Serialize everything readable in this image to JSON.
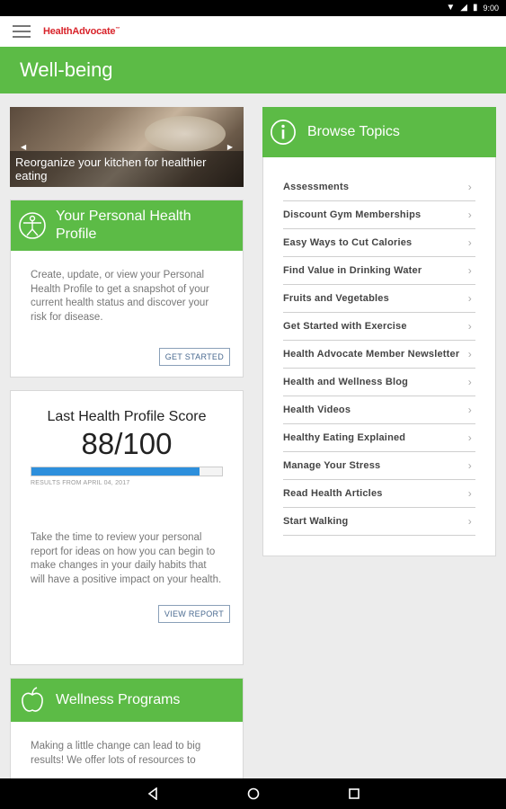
{
  "status_bar": {
    "time": "9:00"
  },
  "app": {
    "logo": "HealthAdvocate",
    "logo_mark": "™",
    "page_title": "Well-being"
  },
  "hero": {
    "caption": "Reorganize your kitchen for healthier eating"
  },
  "personal_health": {
    "title": "Your Personal Health Profile",
    "description": "Create, update, or view your Personal Health Profile to get a snapshot of your current health status and discover your risk for disease.",
    "button": "GET STARTED"
  },
  "score": {
    "title": "Last Health Profile Score",
    "value": "88/100",
    "progress_fraction": 0.88,
    "results_label": "RESULTS FROM APRIL 04, 2017",
    "description": "Take the time to review your personal report for ideas on how you can begin to make changes in your daily habits that will have a positive impact on your health.",
    "button": "VIEW REPORT"
  },
  "wellness": {
    "title": "Wellness Programs",
    "description": "Making a little change can lead to big results! We offer lots of resources to"
  },
  "browse": {
    "title": "Browse Topics",
    "topics": [
      "Assessments",
      "Discount Gym Memberships",
      "Easy Ways to Cut Calories",
      "Find Value in Drinking Water",
      "Fruits and Vegetables",
      "Get Started with Exercise",
      "Health Advocate Member Newsletter",
      "Health and Wellness Blog",
      "Health Videos",
      "Healthy Eating Explained",
      "Manage Your Stress",
      "Read Health Articles",
      "Start Walking"
    ]
  },
  "colors": {
    "brand_green": "#5cbb46",
    "logo_red": "#d8232a",
    "progress_blue": "#2d8fdc"
  },
  "icons": [
    "menu-icon",
    "vitruvian-icon",
    "info-icon",
    "apple-icon",
    "chevron-right-icon",
    "back-icon",
    "home-icon",
    "recents-icon",
    "wifi-icon",
    "signal-icon",
    "battery-icon"
  ]
}
